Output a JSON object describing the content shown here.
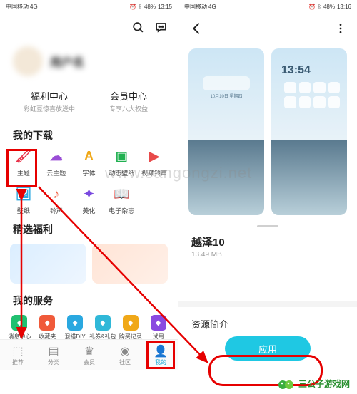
{
  "status": {
    "carrier": "中国移动",
    "signal": "4G",
    "battery": "48%",
    "time_left": "13:15",
    "time_right": "13:16",
    "alarm_icon": "alarm",
    "bt_icon": "bt"
  },
  "left": {
    "profile": {
      "username": "用户名"
    },
    "centers": [
      {
        "title": "福利中心",
        "sub": "彩虹豆惊喜放送中"
      },
      {
        "title": "会员中心",
        "sub": "专享八大权益"
      }
    ],
    "downloads_title": "我的下载",
    "download_items": [
      {
        "label": "主题",
        "color": "#e8334a"
      },
      {
        "label": "云主题",
        "color": "#9a4dd6"
      },
      {
        "label": "字体",
        "color": "#f0a818"
      },
      {
        "label": "动态壁纸",
        "color": "#20b050"
      },
      {
        "label": "视频铃声",
        "color": "#e84a4a"
      },
      {
        "label": "壁纸",
        "color": "#2aa8e0"
      },
      {
        "label": "铃声",
        "color": "#f05a3a"
      },
      {
        "label": "美化",
        "color": "#7a4ae0"
      },
      {
        "label": "电子杂志",
        "color": "#20b8b0"
      }
    ],
    "welfare_title": "精选福利",
    "services_title": "我的服务",
    "service_items": [
      {
        "label": "消息中心",
        "color": "#20c070"
      },
      {
        "label": "收藏夹",
        "color": "#f05a3a"
      },
      {
        "label": "混搭DIY",
        "color": "#2aa8e0"
      },
      {
        "label": "礼券&礼包",
        "color": "#30b8d8"
      },
      {
        "label": "购买记录",
        "color": "#f0a818"
      },
      {
        "label": "试用",
        "color": "#8a4ae0"
      }
    ],
    "nav": [
      {
        "label": "推荐"
      },
      {
        "label": "分类"
      },
      {
        "label": "会员"
      },
      {
        "label": "社区"
      },
      {
        "label": "我的"
      }
    ]
  },
  "right": {
    "theme_name": "越泽10",
    "theme_size": "13.49 MB",
    "preview_time": "13:54",
    "preview_date": "10月10日 星期四",
    "future_title": "资源简介",
    "apply_label": "应用"
  },
  "watermark": "www.sangongzi.net",
  "brand": "三公子游戏网"
}
